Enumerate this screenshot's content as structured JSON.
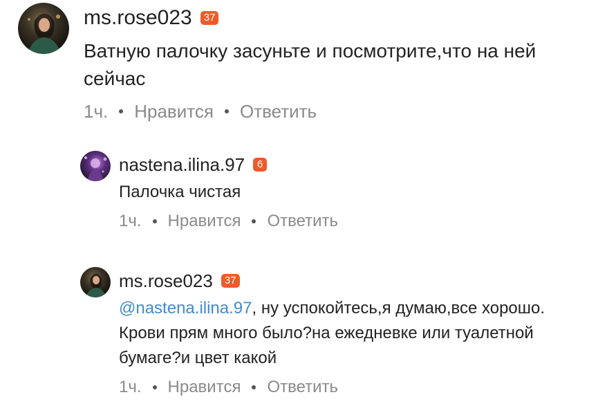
{
  "comments": [
    {
      "username": "ms.rose023",
      "badge": "37",
      "text": "Ватную палочку засуньте и посмотрите,что на ней сейчас",
      "time": "1ч.",
      "like_label": "Нравится",
      "reply_label": "Ответить",
      "avatar_icon": "user-avatar-photo"
    },
    {
      "username": "nastena.ilina.97",
      "badge": "6",
      "text": "Палочка чистая",
      "time": "1ч.",
      "like_label": "Нравится",
      "reply_label": "Ответить",
      "avatar_icon": "user-avatar-photo"
    },
    {
      "username": "ms.rose023",
      "badge": "37",
      "mention": "@nastena.ilina.97",
      "text": ", ну успокойтесь,я думаю,все хорошо. Крови прям много было?на ежедневке или туалетной бумаге?и цвет какой",
      "time": "1ч.",
      "like_label": "Нравится",
      "reply_label": "Ответить",
      "avatar_icon": "user-avatar-photo"
    }
  ],
  "colors": {
    "badge": "#ee5b2b",
    "mention": "#3f8ccf",
    "meta_text": "#8a8a8a",
    "text": "#222222"
  }
}
